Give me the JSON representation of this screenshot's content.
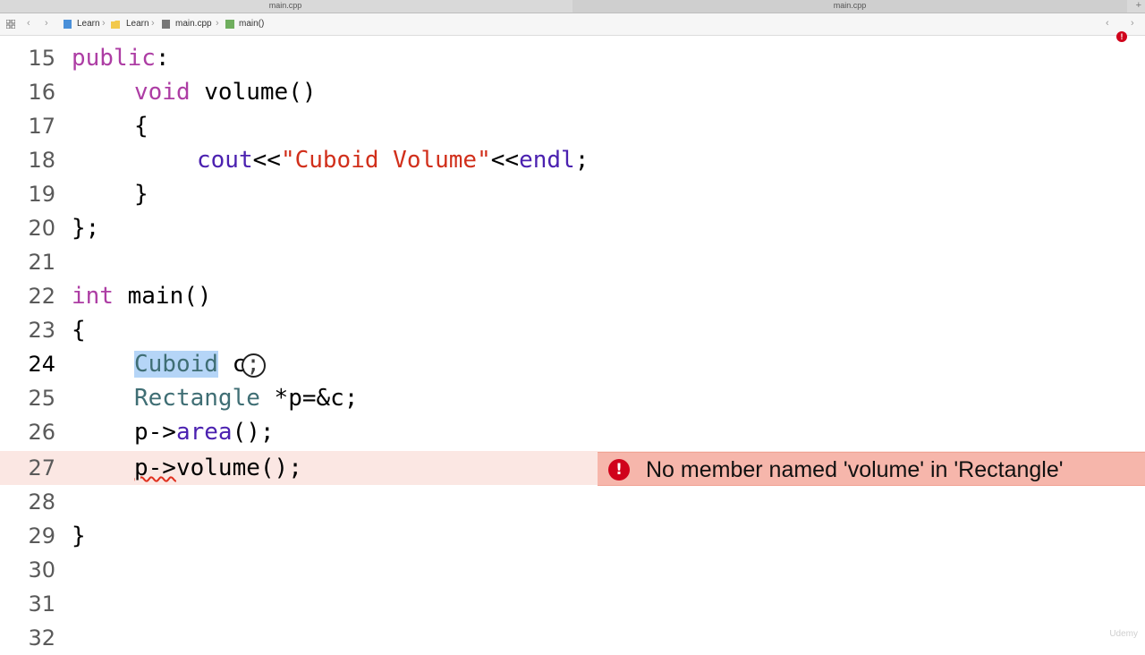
{
  "tabs": {
    "left": "main.cpp",
    "right": "main.cpp",
    "add": "+"
  },
  "jumpbar": {
    "items": [
      "Learn",
      "Learn",
      "main.cpp",
      "main()"
    ]
  },
  "code": {
    "lines": [
      {
        "n": "15"
      },
      {
        "n": "16"
      },
      {
        "n": "17"
      },
      {
        "n": "18"
      },
      {
        "n": "19"
      },
      {
        "n": "20"
      },
      {
        "n": "21"
      },
      {
        "n": "22"
      },
      {
        "n": "23"
      },
      {
        "n": "24"
      },
      {
        "n": "25"
      },
      {
        "n": "26"
      },
      {
        "n": "27"
      },
      {
        "n": "28"
      },
      {
        "n": "29"
      },
      {
        "n": "30"
      },
      {
        "n": "31"
      },
      {
        "n": "32"
      }
    ],
    "text": {
      "l15_kw": "public",
      "l15_rest": ":",
      "l16_kw": "void",
      "l16_rest": " volume()",
      "l17": "{",
      "l18_fn": "cout",
      "l18_op1": "<<",
      "l18_str": "\"Cuboid Volume\"",
      "l18_op2": "<<",
      "l18_fn2": "endl",
      "l18_end": ";",
      "l19": "}",
      "l20": "};",
      "l22_kw": "int",
      "l22_rest": " main()",
      "l23": "{",
      "l24_ty": "Cuboid",
      "l24_rest": " c;",
      "l25_ty": "Rectangle",
      "l25_rest": " *p=&c;",
      "l26_id": "p->",
      "l26_fn": "area",
      "l26_rest": "();",
      "l27_id": "p->",
      "l27_fn": "volume",
      "l27_rest": "();",
      "l29": "}"
    }
  },
  "error": {
    "message": "No member named 'volume' in 'Rectangle'",
    "icon": "!"
  },
  "watermark": "Udemy"
}
